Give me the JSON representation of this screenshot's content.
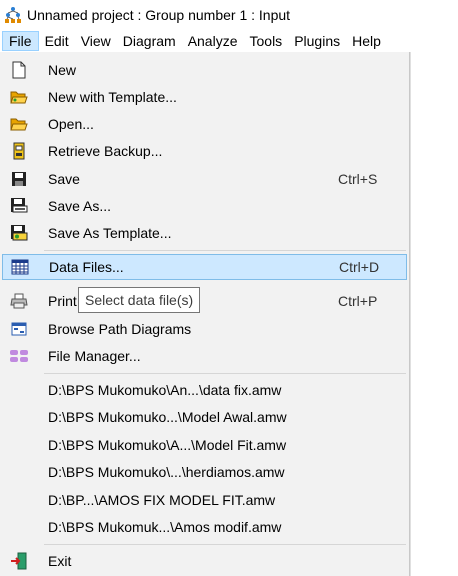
{
  "window": {
    "title": "Unnamed project : Group number 1 : Input"
  },
  "menubar": {
    "items": [
      "File",
      "Edit",
      "View",
      "Diagram",
      "Analyze",
      "Tools",
      "Plugins",
      "Help"
    ]
  },
  "file_menu": {
    "new": "New",
    "new_template": "New with Template...",
    "open": "Open...",
    "retrieve_backup": "Retrieve Backup...",
    "save": "Save",
    "save_shortcut": "Ctrl+S",
    "save_as": "Save As...",
    "save_as_template": "Save As  Template...",
    "data_files": "Data Files...",
    "data_files_shortcut": "Ctrl+D",
    "print": "Print...",
    "print_shortcut": "Ctrl+P",
    "browse_path": "Browse Path Diagrams",
    "file_manager": "File Manager...",
    "recent": [
      "D:\\BPS Mukomuko\\An...\\data fix.amw",
      "D:\\BPS Mukomuko...\\Model Awal.amw",
      "D:\\BPS Mukomuko\\A...\\Model Fit.amw",
      "D:\\BPS Mukomuko\\...\\herdiamos.amw",
      "D:\\BP...\\AMOS FIX MODEL FIT.amw",
      "D:\\BPS Mukomuk...\\Amos modif.amw"
    ],
    "exit": "Exit"
  },
  "tooltip": {
    "text": "Select data file(s)"
  },
  "icons": {
    "new": "blank-page-icon",
    "new_template": "folder-open-icon",
    "open": "folder-open-icon",
    "retrieve_backup": "backup-icon",
    "save": "floppy-disk-icon",
    "save_as": "save-as-icon",
    "save_as_template": "save-template-icon",
    "data_files": "grid-icon",
    "print": "printer-icon",
    "browse_path": "window-icon",
    "file_manager": "file-manager-icon",
    "exit": "exit-door-icon"
  },
  "colors": {
    "highlight": "#cde8ff",
    "highlight_border": "#7fbce8",
    "menu_bg": "#f2f2f2"
  }
}
